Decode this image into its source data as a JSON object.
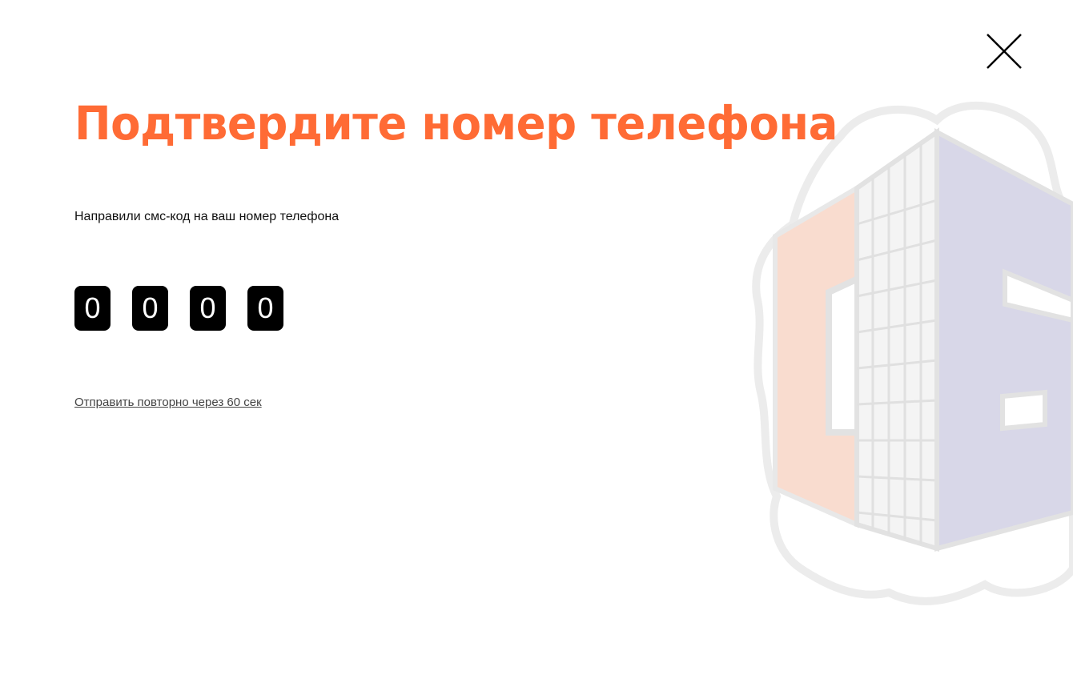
{
  "modal": {
    "title": "Подтвердите номер телефона",
    "subtitle": "Направили смс-код на ваш номер телефона",
    "code_digits": [
      "0",
      "0",
      "0",
      "0"
    ],
    "resend_text": "Отправить повторно через 60 сек",
    "close_icon": "close-x-icon"
  },
  "colors": {
    "accent": "#ff6b35",
    "code_box_bg": "#000000",
    "code_box_text": "#ffffff",
    "logo_orange": "#f9dccf",
    "logo_blue": "#d8d7e8",
    "logo_outline": "#e6e6e6"
  }
}
